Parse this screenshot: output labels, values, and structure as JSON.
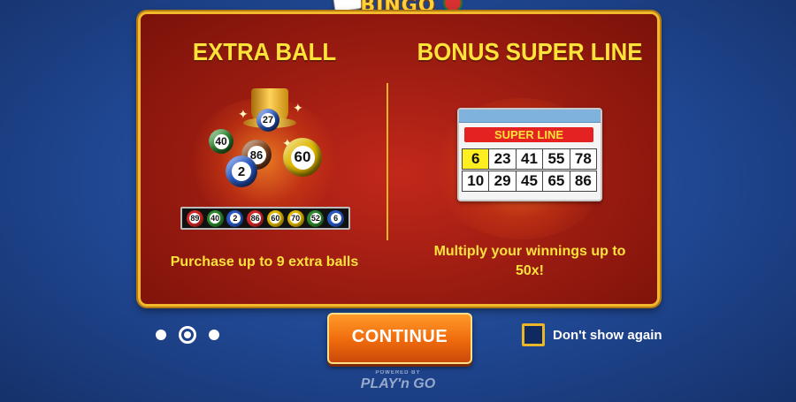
{
  "logo": {
    "text": "BINGO"
  },
  "panels": {
    "left": {
      "heading": "EXTRA BALL",
      "description": "Purchase up to 9 extra balls",
      "display_balls": [
        {
          "number": "27",
          "color": "#2a5ac8"
        },
        {
          "number": "40",
          "color": "#2e8a2e"
        },
        {
          "number": "86",
          "color": "#8a4a20"
        },
        {
          "number": "60",
          "color": "#e0b800"
        },
        {
          "number": "2",
          "color": "#2a5ac8"
        }
      ],
      "tray_balls": [
        {
          "number": "89",
          "color": "#d62828"
        },
        {
          "number": "40",
          "color": "#2e8a2e"
        },
        {
          "number": "2",
          "color": "#2a5ac8"
        },
        {
          "number": "86",
          "color": "#d62828"
        },
        {
          "number": "60",
          "color": "#e0b800"
        },
        {
          "number": "70",
          "color": "#e0b800"
        },
        {
          "number": "52",
          "color": "#2e8a2e"
        },
        {
          "number": "6",
          "color": "#2a5ac8"
        }
      ]
    },
    "right": {
      "heading": "BONUS SUPER LINE",
      "description": "Multiply your winnings up to 50x!",
      "card": {
        "banner": "SUPER LINE",
        "rows": [
          [
            "6",
            "23",
            "41",
            "55",
            "78"
          ],
          [
            "10",
            "29",
            "45",
            "65",
            "86"
          ]
        ],
        "highlight_color": "#ffef20"
      }
    }
  },
  "pagination": {
    "total": 3,
    "active_index": 1
  },
  "continue_label": "CONTINUE",
  "dont_show_again": {
    "label": "Don't show again",
    "checked": false
  },
  "brand": {
    "powered_by": "POWERED BY",
    "name": "PLAY'n GO"
  },
  "colors": {
    "gold": "#e9b529",
    "accent_orange": "#ef6a0c",
    "panel_red": "#a01d12"
  }
}
